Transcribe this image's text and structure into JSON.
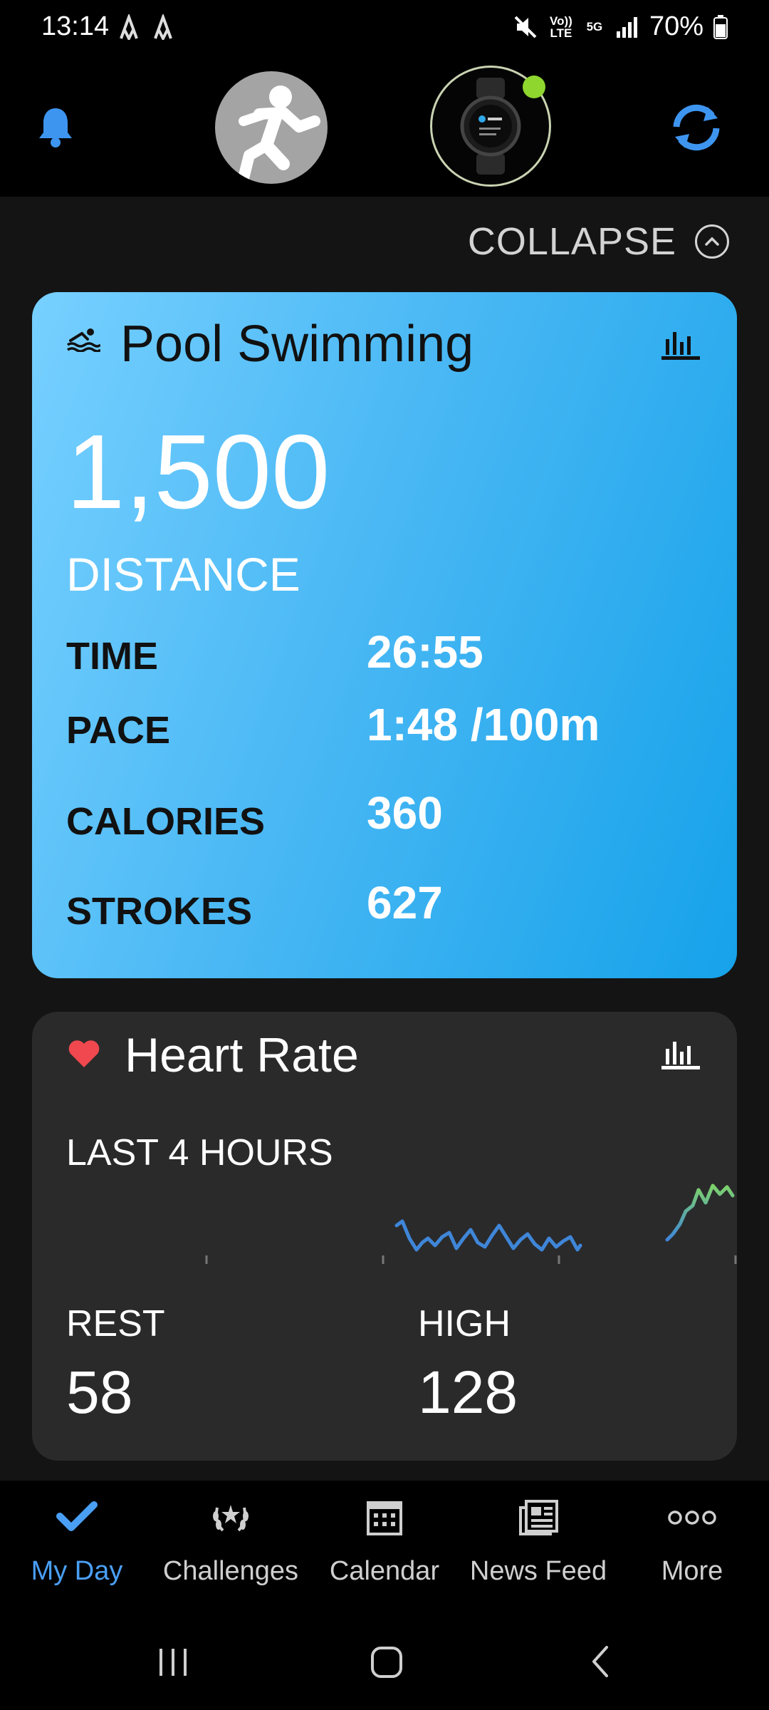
{
  "status_bar": {
    "time": "13:14",
    "network": "5G",
    "volte": "Vo)) LTE",
    "battery": "70%"
  },
  "header": {
    "notification_icon": "bell-icon",
    "avatar_icon": "runner-icon",
    "device_icon": "watch-icon",
    "sync_icon": "sync-icon"
  },
  "collapse": {
    "label": "COLLAPSE"
  },
  "swim_card": {
    "title": "Pool Swimming",
    "distance_value": "1,500",
    "distance_label": "DISTANCE",
    "stats": [
      {
        "label": "TIME",
        "value": "26:55"
      },
      {
        "label": "PACE",
        "value": "1:48 /100m"
      },
      {
        "label": "CALORIES",
        "value": "360"
      },
      {
        "label": "STROKES",
        "value": "627"
      }
    ],
    "colors": {
      "gradient_start": "#77d0ff",
      "gradient_end": "#16a2ea"
    }
  },
  "heart_rate": {
    "title": "Heart Rate",
    "subtitle": "LAST 4 HOURS",
    "rest_label": "REST",
    "rest_value": "58",
    "high_label": "HIGH",
    "high_value": "128",
    "heart_color": "#f0484e"
  },
  "bottom_nav": {
    "items": [
      {
        "label": "My Day",
        "icon": "check-icon",
        "active": true
      },
      {
        "label": "Challenges",
        "icon": "laurel-icon",
        "active": false
      },
      {
        "label": "Calendar",
        "icon": "calendar-icon",
        "active": false
      },
      {
        "label": "News Feed",
        "icon": "newspaper-icon",
        "active": false
      },
      {
        "label": "More",
        "icon": "more-icon",
        "active": false
      }
    ],
    "accent": "#4a9ff5"
  }
}
